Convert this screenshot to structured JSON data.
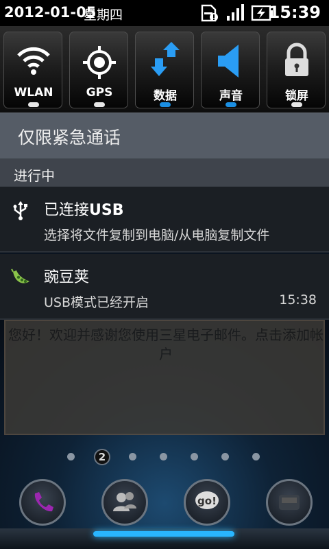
{
  "statusbar": {
    "date": "2012-01-05",
    "weekday": "星期四",
    "time": "15:39"
  },
  "quick_settings": [
    {
      "label": "WLAN",
      "icon": "wifi-icon",
      "active": false
    },
    {
      "label": "GPS",
      "icon": "gps-icon",
      "active": false
    },
    {
      "label": "数据",
      "icon": "data-arrows-icon",
      "active": true
    },
    {
      "label": "声音",
      "icon": "speaker-icon",
      "active": true
    },
    {
      "label": "锁屏",
      "icon": "lock-icon",
      "active": false
    }
  ],
  "emergency_text": "仅限紧急通话",
  "ongoing_header": "进行中",
  "notifications": [
    {
      "icon": "usb-icon",
      "title_prefix": "已连接",
      "title_bold": "USB",
      "subtitle": "选择将文件复制到电脑/从电脑复制文件",
      "time": ""
    },
    {
      "icon": "peapod-icon",
      "title_prefix": "豌豆荚",
      "title_bold": "",
      "subtitle": "USB模式已经开启",
      "time": "15:38"
    }
  ],
  "homescreen": {
    "widget_text": "您好！欢迎并感谢您使用三星电子邮件。点击添加帐户",
    "current_page": "2",
    "accent_color": "#29b6ff"
  }
}
